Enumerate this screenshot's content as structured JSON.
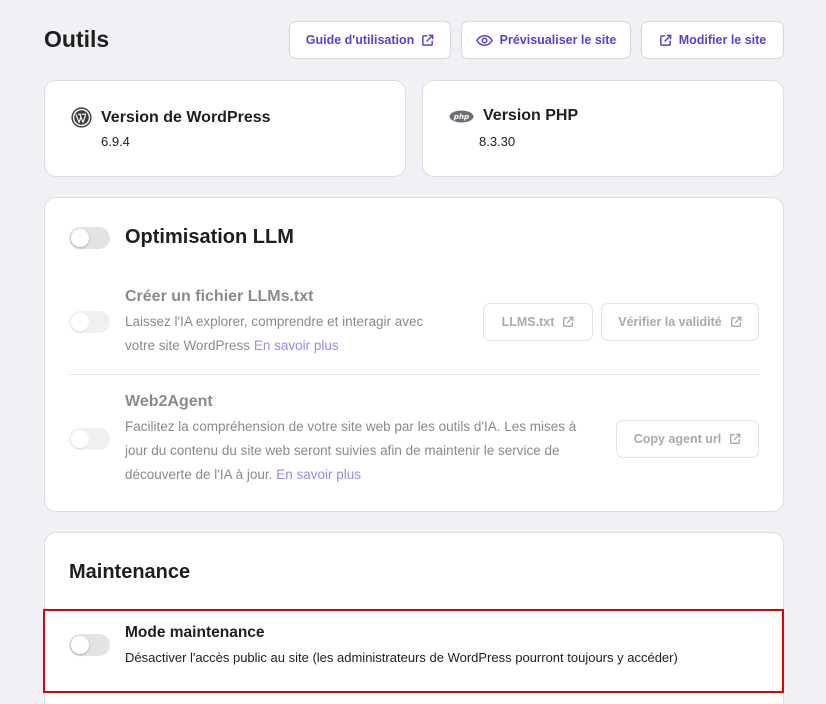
{
  "header": {
    "title": "Outils",
    "buttons": {
      "guide": "Guide d'utilisation",
      "preview": "Prévisualiser le site",
      "edit": "Modifier le site"
    }
  },
  "versions": {
    "wordpress": {
      "label": "Version de WordPress",
      "value": "6.9.4",
      "icon": "wordpress-icon"
    },
    "php": {
      "label": "Version PHP",
      "value": "8.3.30",
      "icon": "php-icon"
    }
  },
  "llm": {
    "title": "Optimisation LLM",
    "enabled": false,
    "llms_txt": {
      "title": "Créer un fichier LLMs.txt",
      "desc_line1": "Laissez l'IA explorer, comprendre et interagir avec",
      "desc_line2": "votre site WordPress",
      "link": "En savoir plus",
      "btn_file": "LLMS.txt",
      "btn_verify": "Vérifier la validité"
    },
    "web2agent": {
      "title": "Web2Agent",
      "desc_line1": "Facilitez la compréhension de votre site web par les outils d'IA. Les mises à",
      "desc_line2": "jour du contenu du site web seront suivies afin de maintenir le service de",
      "desc_line3": "découverte de l'IA à jour.",
      "link": "En savoir plus",
      "btn_copy": "Copy agent url"
    }
  },
  "maintenance": {
    "title": "Maintenance",
    "mode_title": "Mode maintenance",
    "mode_desc": "Désactiver l'accès public au site (les administrateurs de WordPress pourront toujours y accéder)",
    "enabled": false
  },
  "colors": {
    "accent": "#5b3fd6",
    "link": "#9b8ae6",
    "highlight": "#e00000",
    "background": "#f0f0f5"
  }
}
